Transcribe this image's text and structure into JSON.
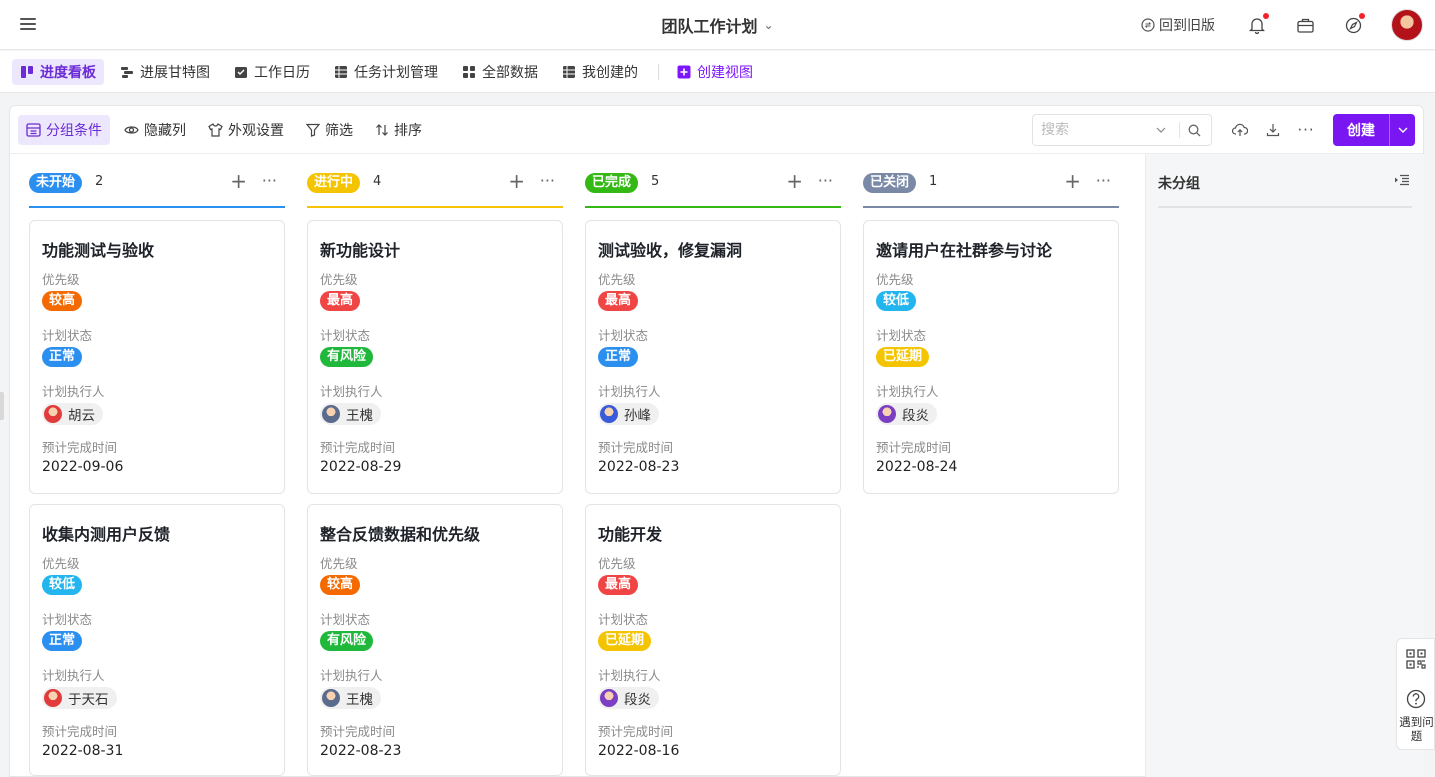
{
  "header": {
    "title": "团队工作计划",
    "old_version": "回到旧版"
  },
  "views": [
    {
      "label": "进度看板",
      "icon": "kanban-icon",
      "active": true
    },
    {
      "label": "进展甘特图",
      "icon": "gantt-icon"
    },
    {
      "label": "工作日历",
      "icon": "calendar-icon"
    },
    {
      "label": "任务计划管理",
      "icon": "table-icon"
    },
    {
      "label": "全部数据",
      "icon": "grid-icon"
    },
    {
      "label": "我创建的",
      "icon": "table-icon"
    }
  ],
  "create_view": "创建视图",
  "toolbar": {
    "group": "分组条件",
    "hide_cols": "隐藏列",
    "appearance": "外观设置",
    "filter": "筛选",
    "sort": "排序",
    "search_placeholder": "搜索",
    "create": "创建"
  },
  "field_labels": {
    "priority": "优先级",
    "plan_status": "计划状态",
    "assignee": "计划执行人",
    "due": "预计完成时间"
  },
  "columns": [
    {
      "status": "未开始",
      "count": "2",
      "color": "#2b8ff0",
      "cards": [
        {
          "title": "功能测试与验收",
          "priority": "较高",
          "priority_color": "#f56a00",
          "plan_status": "正常",
          "plan_status_color": "#2b8ff0",
          "assignee": "胡云",
          "avatar": "red",
          "due": "2022-09-06"
        },
        {
          "title": "收集内测用户反馈",
          "priority": "较低",
          "priority_color": "#22b5ee",
          "plan_status": "正常",
          "plan_status_color": "#2b8ff0",
          "assignee": "于天石",
          "avatar": "red",
          "due": "2022-08-31"
        }
      ]
    },
    {
      "status": "进行中",
      "count": "4",
      "color": "#f5c400",
      "cards": [
        {
          "title": "新功能设计",
          "priority": "最高",
          "priority_color": "#f04545",
          "plan_status": "有风险",
          "plan_status_color": "#1fb83b",
          "assignee": "王槐",
          "avatar": "gray",
          "due": "2022-08-29"
        },
        {
          "title": "整合反馈数据和优先级",
          "priority": "较高",
          "priority_color": "#f56a00",
          "plan_status": "有风险",
          "plan_status_color": "#1fb83b",
          "assignee": "王槐",
          "avatar": "gray",
          "due": "2022-08-23"
        }
      ]
    },
    {
      "status": "已完成",
      "count": "5",
      "color": "#33b814",
      "cards": [
        {
          "title": "测试验收，修复漏洞",
          "priority": "最高",
          "priority_color": "#f04545",
          "plan_status": "正常",
          "plan_status_color": "#2b8ff0",
          "assignee": "孙峰",
          "avatar": "blue",
          "due": "2022-08-23"
        },
        {
          "title": "功能开发",
          "priority": "最高",
          "priority_color": "#f04545",
          "plan_status": "已延期",
          "plan_status_color": "#f5c400",
          "assignee": "段炎",
          "avatar": "purple",
          "due": "2022-08-16"
        }
      ]
    },
    {
      "status": "已关闭",
      "count": "1",
      "color": "#7a8aa6",
      "cards": [
        {
          "title": "邀请用户在社群参与讨论",
          "priority": "较低",
          "priority_color": "#22b5ee",
          "plan_status": "已延期",
          "plan_status_color": "#f5c400",
          "assignee": "段炎",
          "avatar": "purple",
          "due": "2022-08-24"
        }
      ]
    }
  ],
  "ungrouped": "未分组",
  "float_help": "遇到问题"
}
